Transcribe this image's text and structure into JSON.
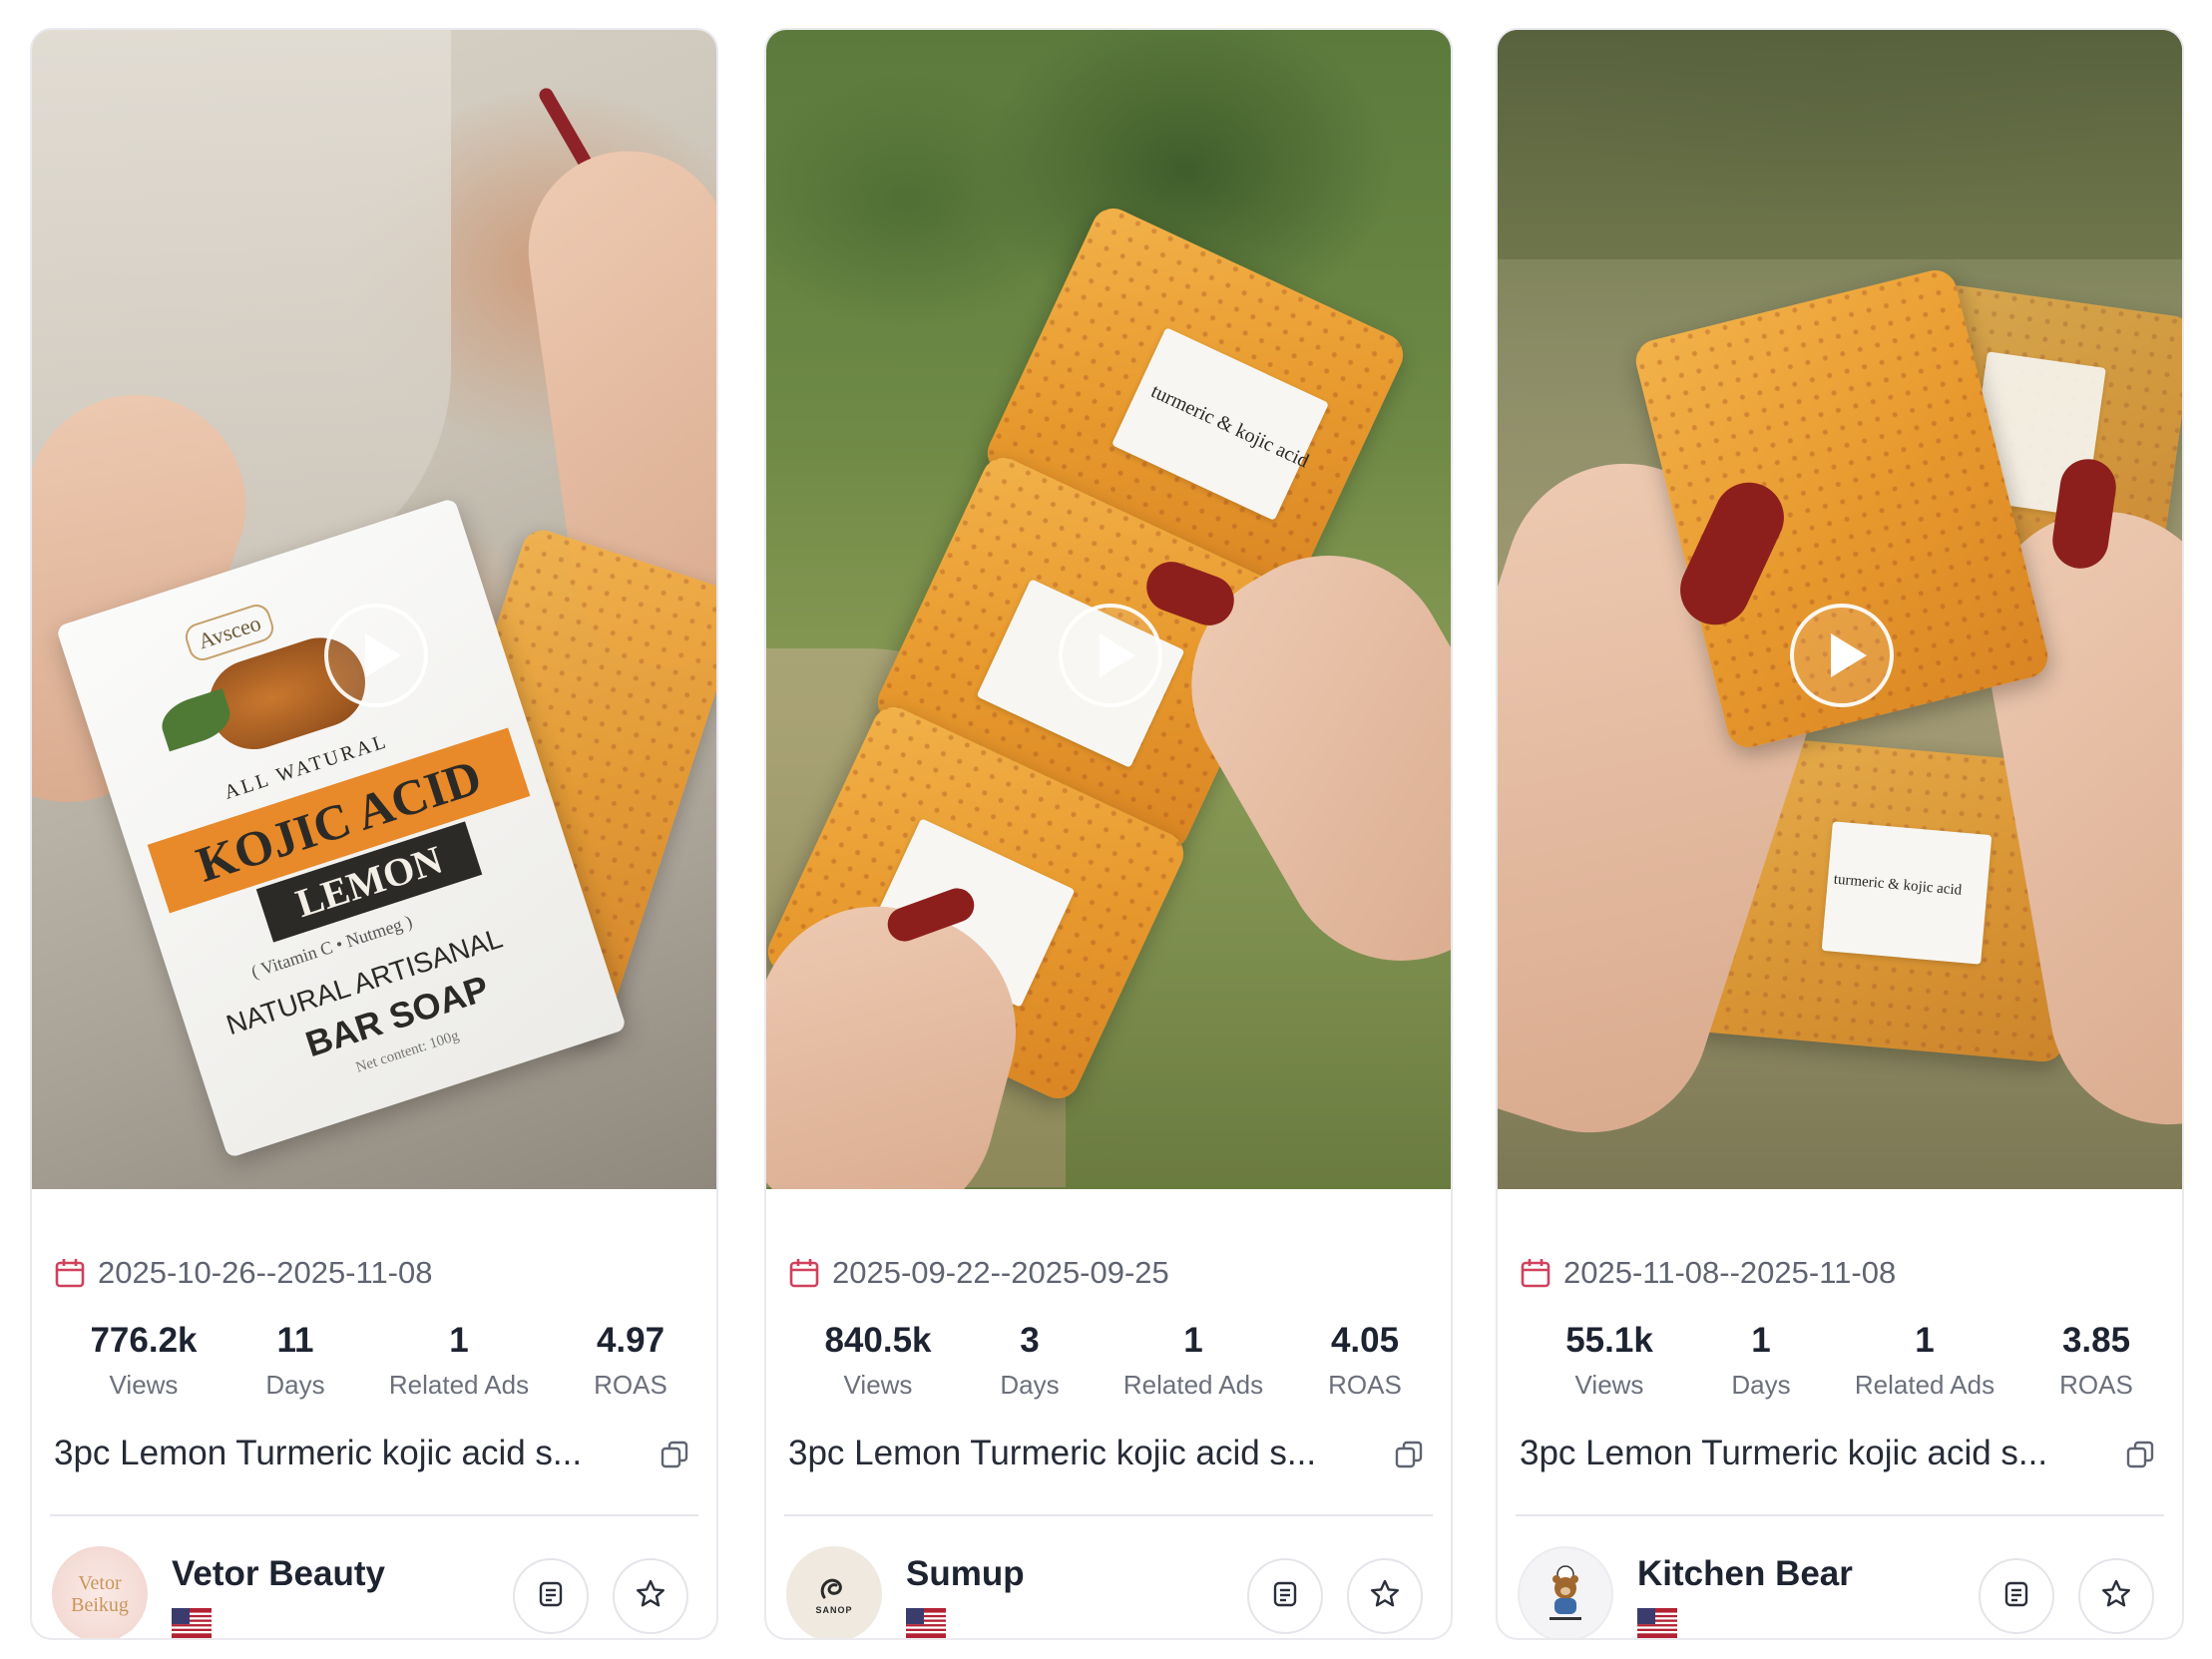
{
  "cards": [
    {
      "date_range": "2025-10-26--2025-11-08",
      "stats": [
        {
          "value": "776.2k",
          "label": "Views"
        },
        {
          "value": "11",
          "label": "Days"
        },
        {
          "value": "1",
          "label": "Related Ads"
        },
        {
          "value": "4.97",
          "label": "ROAS"
        }
      ],
      "title": "3pc Lemon Turmeric kojic acid s...",
      "shop_name": "Vetor Beauty",
      "avatar_text": "Vetor Beikug",
      "package_text": {
        "brand": "Avsceo",
        "line1": "ALL WATURAL",
        "line2": "KOJIC ACID",
        "line3": "LEMON",
        "line4": "( Vitamin C • Nutmeg )",
        "line5": "NATURAL ARTISANAL",
        "line6": "BAR SOAP",
        "line7": "Net content: 100g"
      }
    },
    {
      "date_range": "2025-09-22--2025-09-25",
      "stats": [
        {
          "value": "840.5k",
          "label": "Views"
        },
        {
          "value": "3",
          "label": "Days"
        },
        {
          "value": "1",
          "label": "Related Ads"
        },
        {
          "value": "4.05",
          "label": "ROAS"
        }
      ],
      "title": "3pc Lemon Turmeric kojic acid s...",
      "shop_name": "Sumup",
      "avatar_text": "SANOP",
      "label_text": "turmeric & kojic acid"
    },
    {
      "date_range": "2025-11-08--2025-11-08",
      "stats": [
        {
          "value": "55.1k",
          "label": "Views"
        },
        {
          "value": "1",
          "label": "Days"
        },
        {
          "value": "1",
          "label": "Related Ads"
        },
        {
          "value": "3.85",
          "label": "ROAS"
        }
      ],
      "title": "3pc Lemon Turmeric kojic acid s...",
      "shop_name": "Kitchen Bear",
      "avatar_text": "",
      "label_text": "turmeric & kojic acid"
    }
  ],
  "icons": {
    "date": "calendar-icon",
    "play": "play-icon",
    "copy": "copy-icon",
    "detail": "document-icon",
    "favorite": "star-icon",
    "flag": "us-flag-icon"
  },
  "colors": {
    "calendar_accent": "#d0415c",
    "text_primary": "#1d2330",
    "text_secondary": "#6b707b",
    "border": "#e6e7eb"
  }
}
